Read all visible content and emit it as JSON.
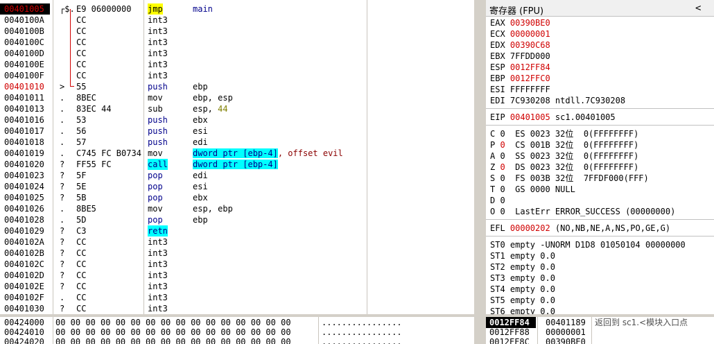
{
  "cpu": {
    "rows": [
      {
        "addr": "00401005",
        "addr_red": true,
        "addr_sel": true,
        "mark": "┌$.",
        "hex": "E9 06000000",
        "mnem": "jmp",
        "mn_class": "hl-yellow mn-black",
        "ops": [
          {
            "t": "main",
            "c": "mn-blue"
          }
        ]
      },
      {
        "addr": "0040100A",
        "mark": "",
        "hex": "CC",
        "mnem": "int3",
        "mn_class": "mn-gray",
        "ops": []
      },
      {
        "addr": "0040100B",
        "mark": "",
        "hex": "CC",
        "mnem": "int3",
        "mn_class": "mn-gray",
        "ops": []
      },
      {
        "addr": "0040100C",
        "mark": "",
        "hex": "CC",
        "mnem": "int3",
        "mn_class": "mn-gray",
        "ops": []
      },
      {
        "addr": "0040100D",
        "mark": "",
        "hex": "CC",
        "mnem": "int3",
        "mn_class": "mn-gray",
        "ops": []
      },
      {
        "addr": "0040100E",
        "mark": "",
        "hex": "CC",
        "mnem": "int3",
        "mn_class": "mn-gray",
        "ops": []
      },
      {
        "addr": "0040100F",
        "mark": "",
        "hex": "CC",
        "mnem": "int3",
        "mn_class": "mn-gray",
        "ops": []
      },
      {
        "addr": "00401010",
        "addr_red": true,
        "mark": ">",
        "hex": "55",
        "mnem": "push",
        "mn_class": "mn-blue",
        "ops": [
          {
            "t": "ebp",
            "c": ""
          }
        ]
      },
      {
        "addr": "00401011",
        "mark": ".",
        "hex": "8BEC",
        "mnem": "mov",
        "mn_class": "mn-black",
        "ops": [
          {
            "t": "ebp, esp",
            "c": ""
          }
        ]
      },
      {
        "addr": "00401013",
        "mark": ".",
        "hex": "83EC 44",
        "mnem": "sub",
        "mn_class": "mn-black",
        "ops": [
          {
            "t": "esp, ",
            "c": ""
          },
          {
            "t": "44",
            "c": "num-olive"
          }
        ]
      },
      {
        "addr": "00401016",
        "mark": ".",
        "hex": "53",
        "mnem": "push",
        "mn_class": "mn-blue",
        "ops": [
          {
            "t": "ebx",
            "c": ""
          }
        ]
      },
      {
        "addr": "00401017",
        "mark": ".",
        "hex": "56",
        "mnem": "push",
        "mn_class": "mn-blue",
        "ops": [
          {
            "t": "esi",
            "c": ""
          }
        ]
      },
      {
        "addr": "00401018",
        "mark": ".",
        "hex": "57",
        "mnem": "push",
        "mn_class": "mn-blue",
        "ops": [
          {
            "t": "edi",
            "c": ""
          }
        ]
      },
      {
        "addr": "00401019",
        "mark": ".",
        "hex": "C745 FC B0734",
        "mnem": "mov",
        "mn_class": "mn-black",
        "ops": [
          {
            "t": "dword ptr [ebp-4]",
            "c": "hl-cyan mn-blue"
          },
          {
            "t": ", offset evil",
            "c": "op-red"
          }
        ]
      },
      {
        "addr": "00401020",
        "mark": "?",
        "hex": "FF55 FC",
        "mnem": "call",
        "mn_class": "hl-cyan mn-blue",
        "ops": [
          {
            "t": "dword ptr [ebp-4]",
            "c": "hl-cyan mn-blue"
          }
        ]
      },
      {
        "addr": "00401023",
        "mark": "?",
        "hex": "5F",
        "mnem": "pop",
        "mn_class": "mn-blue",
        "ops": [
          {
            "t": "edi",
            "c": ""
          }
        ]
      },
      {
        "addr": "00401024",
        "mark": "?",
        "hex": "5E",
        "mnem": "pop",
        "mn_class": "mn-blue",
        "ops": [
          {
            "t": "esi",
            "c": ""
          }
        ]
      },
      {
        "addr": "00401025",
        "mark": "?",
        "hex": "5B",
        "mnem": "pop",
        "mn_class": "mn-blue",
        "ops": [
          {
            "t": "ebx",
            "c": ""
          }
        ]
      },
      {
        "addr": "00401026",
        "mark": ".",
        "hex": "8BE5",
        "mnem": "mov",
        "mn_class": "mn-black",
        "ops": [
          {
            "t": "esp, ebp",
            "c": ""
          }
        ]
      },
      {
        "addr": "00401028",
        "mark": ".",
        "hex": "5D",
        "mnem": "pop",
        "mn_class": "mn-blue",
        "ops": [
          {
            "t": "ebp",
            "c": ""
          }
        ]
      },
      {
        "addr": "00401029",
        "mark": "?",
        "hex": "C3",
        "mnem": "retn",
        "mn_class": "hl-cyan mn-blue",
        "ops": []
      },
      {
        "addr": "0040102A",
        "mark": "?",
        "hex": "CC",
        "mnem": "int3",
        "mn_class": "mn-gray",
        "ops": []
      },
      {
        "addr": "0040102B",
        "mark": "?",
        "hex": "CC",
        "mnem": "int3",
        "mn_class": "mn-gray",
        "ops": []
      },
      {
        "addr": "0040102C",
        "mark": "?",
        "hex": "CC",
        "mnem": "int3",
        "mn_class": "mn-gray",
        "ops": []
      },
      {
        "addr": "0040102D",
        "mark": "?",
        "hex": "CC",
        "mnem": "int3",
        "mn_class": "mn-gray",
        "ops": []
      },
      {
        "addr": "0040102E",
        "mark": "?",
        "hex": "CC",
        "mnem": "int3",
        "mn_class": "mn-gray",
        "ops": []
      },
      {
        "addr": "0040102F",
        "mark": ".",
        "hex": "CC",
        "mnem": "int3",
        "mn_class": "mn-gray",
        "ops": []
      },
      {
        "addr": "00401030",
        "mark": "?",
        "hex": "CC",
        "mnem": "int3",
        "mn_class": "mn-gray",
        "ops": []
      }
    ]
  },
  "registers": {
    "title": "寄存器 (FPU)",
    "collapse_glyph": "<",
    "lines": [
      [
        {
          "t": "EAX "
        },
        {
          "t": "00390BE0",
          "c": "red"
        }
      ],
      [
        {
          "t": "ECX "
        },
        {
          "t": "00000001",
          "c": "red"
        }
      ],
      [
        {
          "t": "EDX "
        },
        {
          "t": "00390C68",
          "c": "red"
        }
      ],
      [
        {
          "t": "EBX 7FFDD000"
        }
      ],
      [
        {
          "t": "ESP "
        },
        {
          "t": "0012FF84",
          "c": "red"
        }
      ],
      [
        {
          "t": "EBP "
        },
        {
          "t": "0012FFC0",
          "c": "red"
        }
      ],
      [
        {
          "t": "ESI FFFFFFFF"
        }
      ],
      [
        {
          "t": "EDI 7C930208 ntdll.7C930208"
        }
      ],
      null,
      [
        {
          "t": "EIP "
        },
        {
          "t": "00401005",
          "c": "red"
        },
        {
          "t": " sc1.00401005"
        }
      ],
      null,
      [
        {
          "t": "C 0  ES 0023 32位  0(FFFFFFFF)"
        }
      ],
      [
        {
          "t": "P "
        },
        {
          "t": "0",
          "c": "red"
        },
        {
          "t": "  CS 001B 32位  0(FFFFFFFF)"
        }
      ],
      [
        {
          "t": "A 0  SS 0023 32位  0(FFFFFFFF)"
        }
      ],
      [
        {
          "t": "Z "
        },
        {
          "t": "0",
          "c": "red"
        },
        {
          "t": "  DS 0023 32位  0(FFFFFFFF)"
        }
      ],
      [
        {
          "t": "S 0  FS 003B 32位  7FFDF000(FFF)"
        }
      ],
      [
        {
          "t": "T 0  GS 0000 NULL"
        }
      ],
      [
        {
          "t": "D 0"
        }
      ],
      [
        {
          "t": "O 0  LastErr ERROR_SUCCESS (00000000)"
        }
      ],
      null,
      [
        {
          "t": "EFL "
        },
        {
          "t": "00000202",
          "c": "red"
        },
        {
          "t": " (NO,NB,NE,A,NS,PO,GE,G)"
        }
      ],
      null,
      [
        {
          "t": "ST0 empty -UNORM D1D8 01050104 00000000"
        }
      ],
      [
        {
          "t": "ST1 empty 0.0"
        }
      ],
      [
        {
          "t": "ST2 empty 0.0"
        }
      ],
      [
        {
          "t": "ST3 empty 0.0"
        }
      ],
      [
        {
          "t": "ST4 empty 0.0"
        }
      ],
      [
        {
          "t": "ST5 empty 0.0"
        }
      ],
      [
        {
          "t": "ST6 empty 0.0"
        }
      ]
    ]
  },
  "dump": {
    "rows": [
      {
        "addr": "00424000",
        "hex": "00 00 00 00 00 00 00 00 00 00 00 00 00 00 00 00",
        "ascii": "................"
      },
      {
        "addr": "00424010",
        "hex": "00 00 00 00 00 00 00 00 00 00 00 00 00 00 00 00",
        "ascii": "................"
      },
      {
        "addr": "00424020",
        "hex": "00 00 00 00 00 00 00 00 00 00 00 00 00 00 00 00",
        "ascii": "................"
      }
    ]
  },
  "stack": {
    "rows": [
      {
        "addr": "0012FF84",
        "value": "00401189",
        "comment": "返回到 sc1.<模块入口点",
        "selected": true
      },
      {
        "addr": "0012FF88",
        "value": "00000001",
        "comment": ""
      },
      {
        "addr": "0012FF8C",
        "value": "00390BE0",
        "comment": ""
      }
    ]
  }
}
